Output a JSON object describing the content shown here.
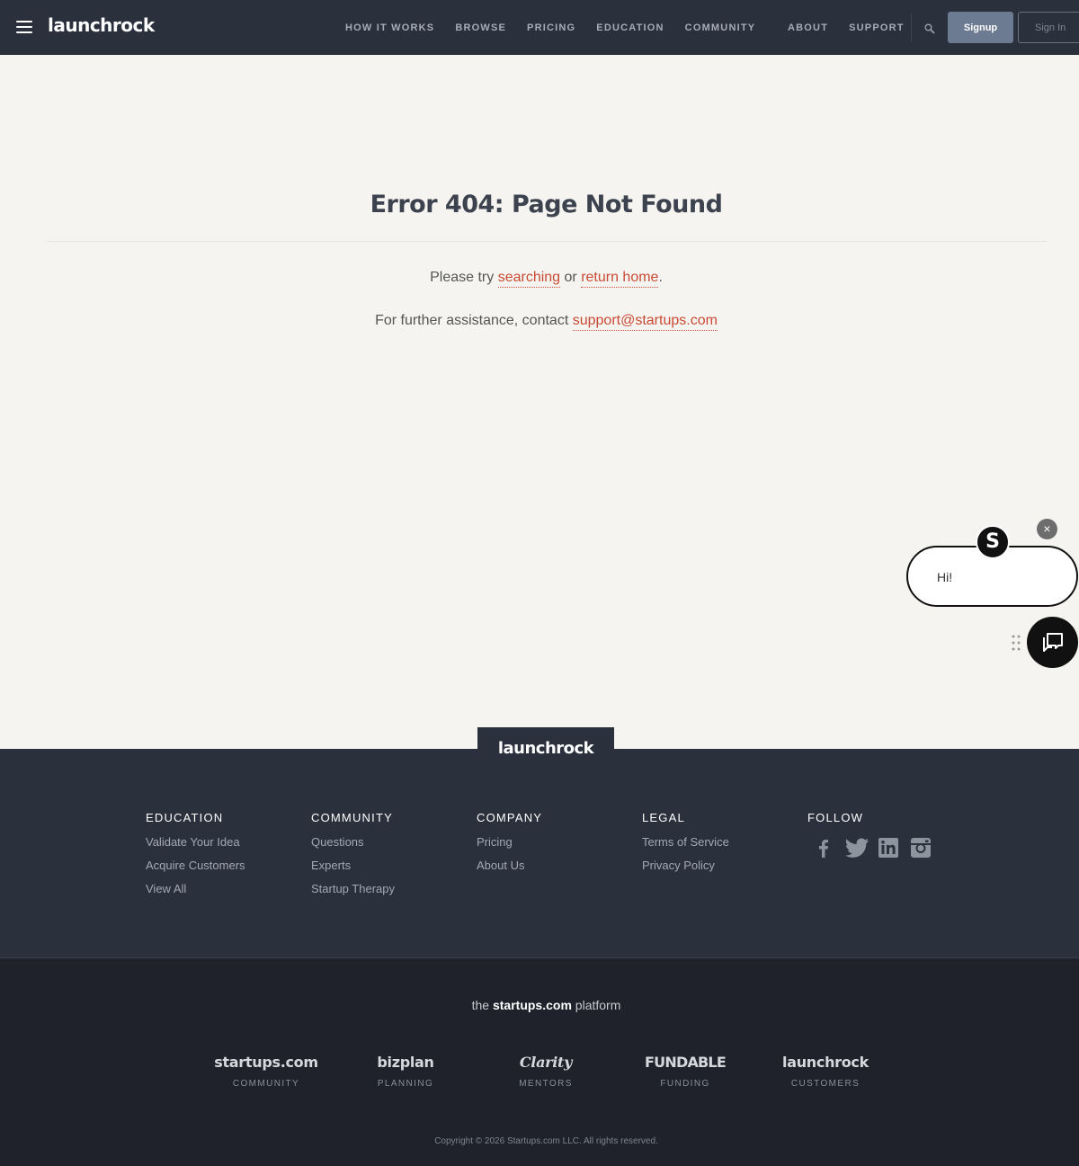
{
  "header": {
    "logo": "launchrock",
    "nav_main": [
      "HOW IT WORKS",
      "BROWSE",
      "PRICING",
      "EDUCATION",
      "COMMUNITY"
    ],
    "nav_right": [
      "ABOUT",
      "SUPPORT"
    ],
    "signup_label": "Signup",
    "signin_label": "Sign In",
    "signup_color": "#6c7a92"
  },
  "main": {
    "title": "Error 404: Page Not Found",
    "line1_prefix": "Please try ",
    "line1_link1": "searching",
    "line1_mid": " or ",
    "line1_link2": "return home",
    "line1_suffix": ".",
    "line2_prefix": "For further assistance, contact ",
    "line2_link": "support@startups.com",
    "link_color": "#c94a34"
  },
  "chat": {
    "greeting": "Hi!",
    "avatar_letter": "S",
    "close_symbol": "×"
  },
  "footer": {
    "logo": "launchrock",
    "columns": [
      {
        "heading": "EDUCATION",
        "links": [
          "Validate Your Idea",
          "Acquire Customers",
          "View All"
        ]
      },
      {
        "heading": "COMMUNITY",
        "links": [
          "Questions",
          "Experts",
          "Startup Therapy"
        ]
      },
      {
        "heading": "COMPANY",
        "links": [
          "Pricing",
          "About Us"
        ]
      },
      {
        "heading": "LEGAL",
        "links": [
          "Terms of Service",
          "Privacy Policy"
        ]
      },
      {
        "heading": "FOLLOW",
        "links": []
      }
    ],
    "social_icons": [
      "facebook-icon",
      "twitter-icon",
      "linkedin-icon",
      "instagram-icon"
    ]
  },
  "subfooter": {
    "platform_prefix": "the ",
    "platform_bold": "startups.com",
    "platform_suffix": " platform",
    "brands": [
      {
        "name": "startups.com",
        "sub": "COMMUNITY"
      },
      {
        "name": "bizplan",
        "sub": "PLANNING"
      },
      {
        "name": "Clarity",
        "sub": "MENTORS"
      },
      {
        "name": "FUNDABLE",
        "sub": "FUNDING"
      },
      {
        "name": "launchrock",
        "sub": "CUSTOMERS"
      }
    ],
    "copyright": "Copyright © 2026 Startups.com LLC. All rights reserved."
  }
}
